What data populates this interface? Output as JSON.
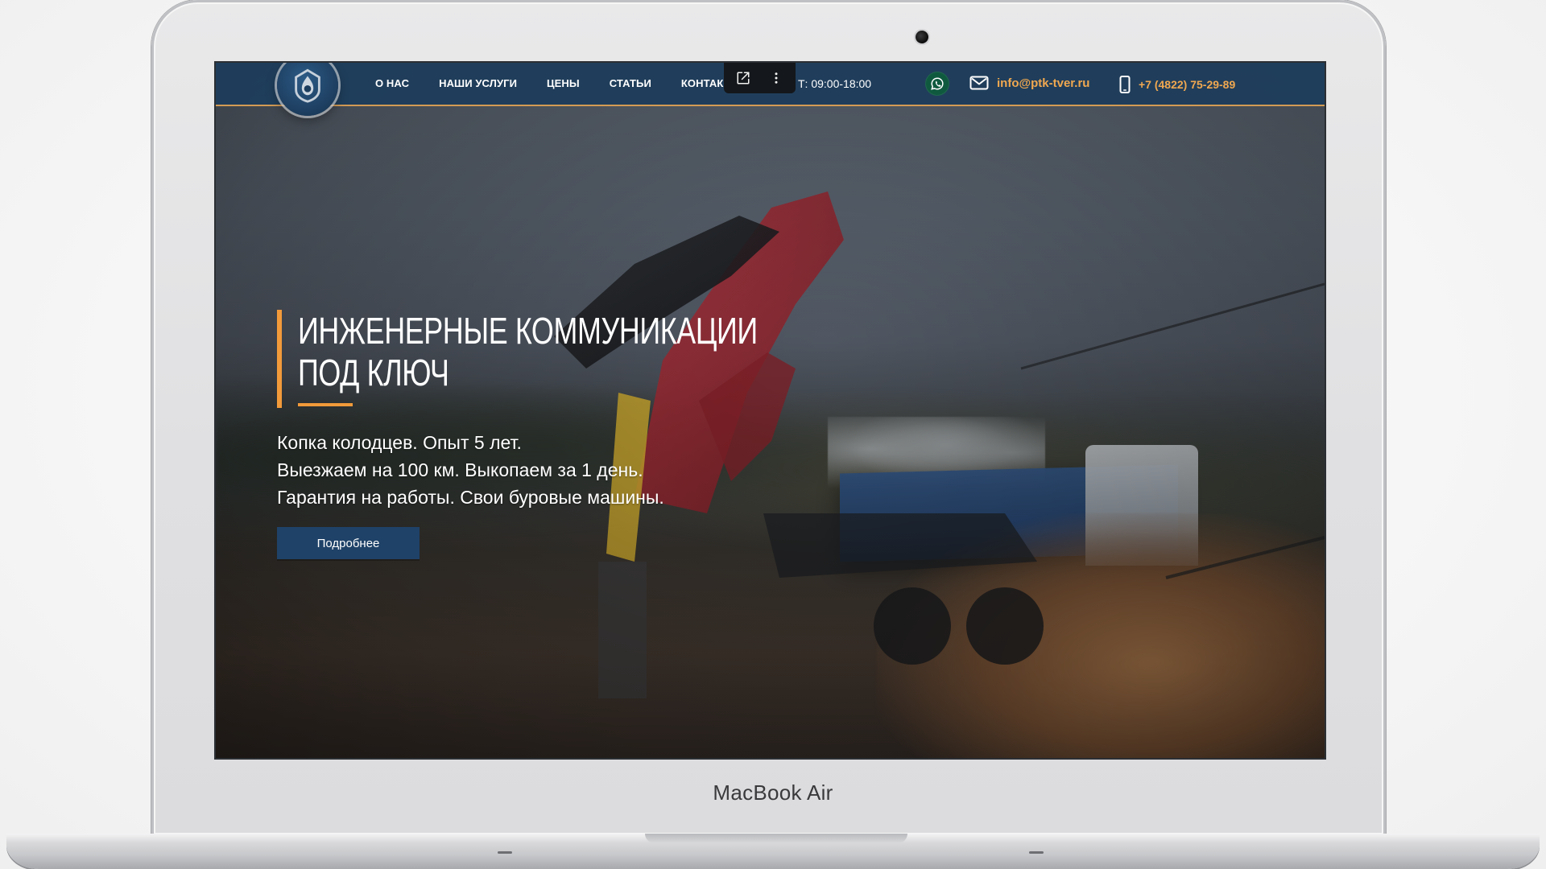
{
  "device": {
    "label": "MacBook Air"
  },
  "site": {
    "nav": {
      "items": [
        {
          "label": "О НАС"
        },
        {
          "label": "НАШИ УСЛУГИ"
        },
        {
          "label": "ЦЕНЫ"
        },
        {
          "label": "СТАТЬИ"
        },
        {
          "label": "КОНТАК"
        }
      ]
    },
    "hours": "Т: 09:00-18:00",
    "contacts": {
      "email": "info@ptk-tver.ru",
      "phone": "+7 (4822) 75-29-89"
    },
    "hero": {
      "title_line_1": "ИНЖЕНЕРНЫЕ КОММУНИКАЦИИ",
      "title_line_2": "ПОД КЛЮЧ",
      "lines": [
        "Копка колодцев. Опыт 5 лет.",
        "Выезжаем на 100 км. Выкопаем за 1 день.",
        "Гарантия на работы. Свои буровые машины."
      ],
      "cta_label": "Подробнее"
    },
    "toolbar_overlay": {
      "open_icon": "external-link-icon",
      "more_icon": "more-vertical-icon"
    },
    "colors": {
      "header_bg": "#1e3d5c",
      "accent_orange": "#f29a3a",
      "link_orange": "#f0a850",
      "cta_bg": "#1f4268",
      "whatsapp_bg": "#0f5a3f"
    },
    "icons": {
      "logo": "company-logo-icon",
      "whatsapp": "whatsapp-icon",
      "email": "mail-icon",
      "phone": "phone-icon"
    }
  }
}
